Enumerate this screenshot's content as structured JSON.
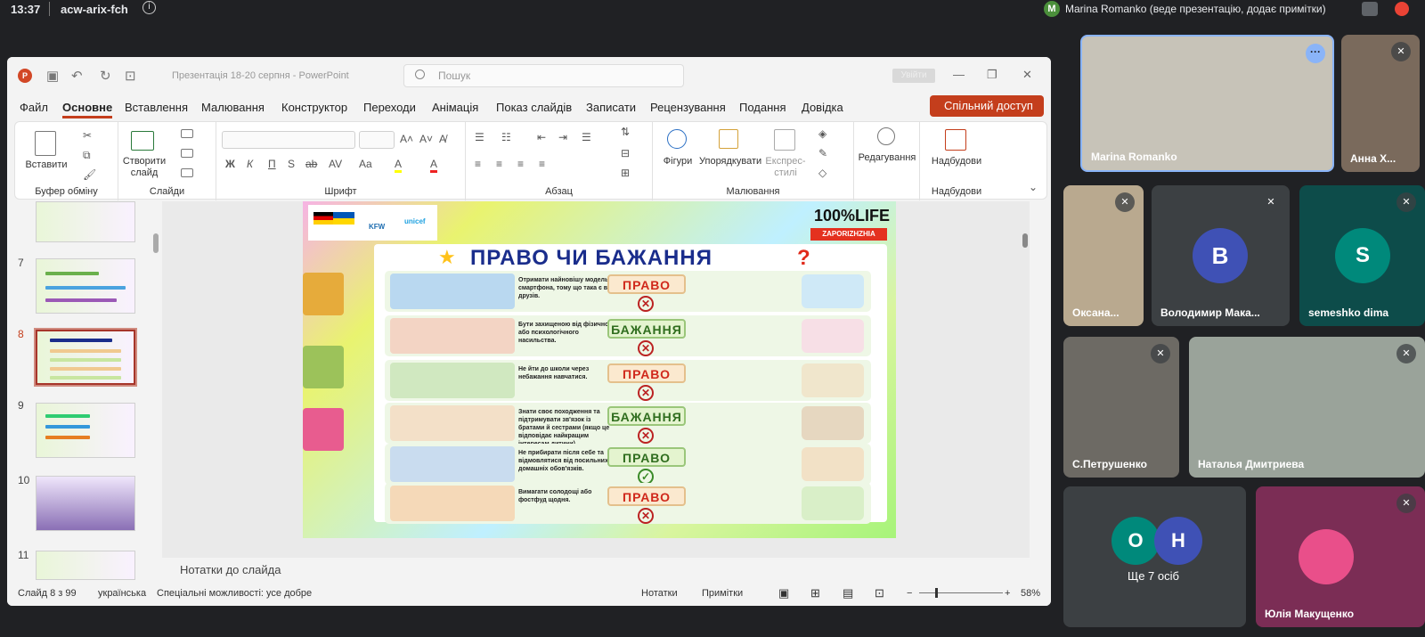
{
  "topbar": {
    "time": "13:37",
    "meeting_code": "acw-arix-fch",
    "presenter_initial": "M",
    "presenter_text": "Marina Romanko (веде презентацію, додає примітки)"
  },
  "ppt": {
    "doc_title": "Презентація 18-20 серпня  -  PowerPoint",
    "search_placeholder": "Пошук",
    "signin_label": "Увійти",
    "menu": [
      "Файл",
      "Основне",
      "Вставлення",
      "Малювання",
      "Конструктор",
      "Переходи",
      "Анімація",
      "Показ слайдів",
      "Записати",
      "Рецензування",
      "Подання",
      "Довідка"
    ],
    "share_label": "Спільний доступ",
    "ribbon": {
      "paste_label": "Вставити",
      "clipboard_label": "Буфер обміну",
      "new_slide_label": "Створити слайд",
      "slides_label": "Слайди",
      "font_label": "Шрифт",
      "paragraph_label": "Абзац",
      "shapes_label": "Фігури",
      "arrange_label": "Упорядкувати",
      "quick_styles_label": "Експрес-стилі",
      "drawing_label": "Малювання",
      "editing_label": "Редагування",
      "addins_label": "Надбудови",
      "addins_group_label": "Надбудови",
      "font_buttons": [
        "Ж",
        "К",
        "П",
        "S",
        "ab",
        "AV",
        "Aa",
        "A",
        "A"
      ]
    },
    "thumbnails": [
      "7",
      "8",
      "9",
      "10",
      "11"
    ],
    "slide": {
      "brand": "100%LIFE",
      "brand_sub": "ZAPORIZHZHIA",
      "logo_kfw": "KFW",
      "logo_unicef": "unicef",
      "title": "ПРАВО ЧИ БАЖАННЯ?",
      "rows": [
        {
          "text": "Отримати найновішу модель смартфона, тому що така є в друзів.",
          "label": "ПРАВО",
          "mark": "✕",
          "kind": "red"
        },
        {
          "text": "Бути захищеною від фізичного або психологічного насильства.",
          "label": "БАЖАННЯ",
          "mark": "✕",
          "kind": "green"
        },
        {
          "text": "Не йти до школи через небажання навчатися.",
          "label": "ПРАВО",
          "mark": "✕",
          "kind": "red"
        },
        {
          "text": "Знати своє походження та підтримувати зв'язок із братами й сестрами (якщо це відповідає найкращим інтересам дитини).",
          "label": "БАЖАННЯ",
          "mark": "✕",
          "kind": "green"
        },
        {
          "text": "Не прибирати після себе та відмовлятися від посильних домашніх обов'язків.",
          "label": "ПРАВО",
          "mark": "✓",
          "kind": "green"
        },
        {
          "text": "Вимагати солодощі або фостфуд щодня.",
          "label": "ПРАВО",
          "mark": "✕",
          "kind": "red"
        }
      ]
    },
    "notes_placeholder": "Нотатки до слайда",
    "status": {
      "slide_of": "Слайд 8 з 99",
      "language": "українська",
      "accessibility": "Спеціальні можливості: усе добре",
      "notes": "Нотатки",
      "comments": "Примітки",
      "zoom": "58%"
    }
  },
  "participants": [
    {
      "name": "Marina Romanko"
    },
    {
      "name": "Анна Х..."
    },
    {
      "name": "Оксана..."
    },
    {
      "name": "Володимир Мака...",
      "initial": "В",
      "color": "#3f51b5"
    },
    {
      "name": "semeshko dima",
      "initial": "S",
      "color": "#00897b"
    },
    {
      "name": "С.Петрушенко"
    },
    {
      "name": "Наталья Дмитриева"
    },
    {
      "name": "Ще 7 осіб",
      "initials": [
        "О",
        "Н"
      ]
    },
    {
      "name": "Юлія Макущенко"
    }
  ]
}
